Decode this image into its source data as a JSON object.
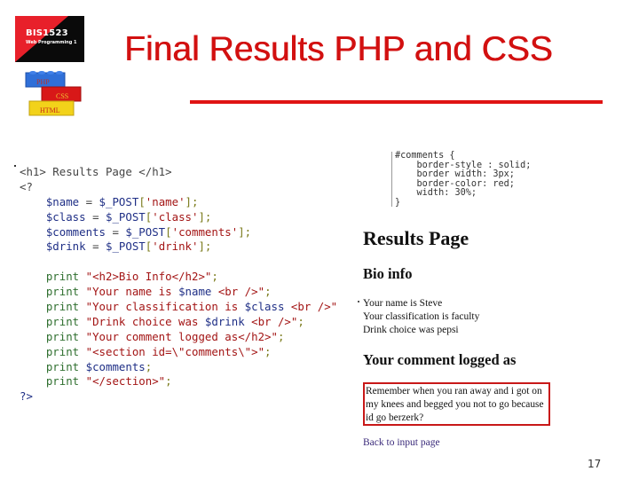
{
  "logo": {
    "course_code": "BIS1523",
    "course_name": "Web Programming 1",
    "bricks": [
      "PHP",
      "CSS",
      "HTML"
    ],
    "colors": {
      "red": "#e8202a",
      "black": "#0a0a0a",
      "blue": "#2f6fd8",
      "brick_red": "#d81818",
      "yellow": "#f2d21a"
    }
  },
  "slide": {
    "title": "Final Results PHP and CSS",
    "title_color": "#d21010",
    "page_number": "17"
  },
  "php_code": {
    "lines": [
      [
        {
          "t": "<h1> Results Page </h1>",
          "c": "tag"
        }
      ],
      [
        {
          "t": "<?",
          "c": "tag"
        }
      ],
      [
        {
          "t": "    "
        },
        {
          "t": "$name",
          "c": "var"
        },
        {
          "t": " = ",
          "c": "tag"
        },
        {
          "t": "$_POST",
          "c": "var"
        },
        {
          "t": "[",
          "c": "punc"
        },
        {
          "t": "'name'",
          "c": "str"
        },
        {
          "t": "];",
          "c": "punc"
        }
      ],
      [
        {
          "t": "    "
        },
        {
          "t": "$class",
          "c": "var"
        },
        {
          "t": " = ",
          "c": "tag"
        },
        {
          "t": "$_POST",
          "c": "var"
        },
        {
          "t": "[",
          "c": "punc"
        },
        {
          "t": "'class'",
          "c": "str"
        },
        {
          "t": "];",
          "c": "punc"
        }
      ],
      [
        {
          "t": "    "
        },
        {
          "t": "$comments",
          "c": "var"
        },
        {
          "t": " = ",
          "c": "tag"
        },
        {
          "t": "$_POST",
          "c": "var"
        },
        {
          "t": "[",
          "c": "punc"
        },
        {
          "t": "'comments'",
          "c": "str"
        },
        {
          "t": "];",
          "c": "punc"
        }
      ],
      [
        {
          "t": "    "
        },
        {
          "t": "$drink",
          "c": "var"
        },
        {
          "t": " = ",
          "c": "tag"
        },
        {
          "t": "$_POST",
          "c": "var"
        },
        {
          "t": "[",
          "c": "punc"
        },
        {
          "t": "'drink'",
          "c": "str"
        },
        {
          "t": "];",
          "c": "punc"
        }
      ],
      [
        {
          "t": ""
        }
      ],
      [
        {
          "t": "    "
        },
        {
          "t": "print",
          "c": "kw"
        },
        {
          "t": " "
        },
        {
          "t": "\"<h2>Bio Info</h2>\"",
          "c": "str"
        },
        {
          "t": ";",
          "c": "punc"
        }
      ],
      [
        {
          "t": "    "
        },
        {
          "t": "print",
          "c": "kw"
        },
        {
          "t": " "
        },
        {
          "t": "\"Your name is ",
          "c": "str"
        },
        {
          "t": "$name",
          "c": "var"
        },
        {
          "t": " <br />\"",
          "c": "str"
        },
        {
          "t": ";",
          "c": "punc"
        }
      ],
      [
        {
          "t": "    "
        },
        {
          "t": "print",
          "c": "kw"
        },
        {
          "t": " "
        },
        {
          "t": "\"Your classification is ",
          "c": "str"
        },
        {
          "t": "$class",
          "c": "var"
        },
        {
          "t": " <br />\"",
          "c": "str"
        }
      ],
      [
        {
          "t": "    "
        },
        {
          "t": "print",
          "c": "kw"
        },
        {
          "t": " "
        },
        {
          "t": "\"Drink choice was ",
          "c": "str"
        },
        {
          "t": "$drink",
          "c": "var"
        },
        {
          "t": " <br />\"",
          "c": "str"
        },
        {
          "t": ";",
          "c": "punc"
        }
      ],
      [
        {
          "t": "    "
        },
        {
          "t": "print",
          "c": "kw"
        },
        {
          "t": " "
        },
        {
          "t": "\"Your comment logged as</h2>\"",
          "c": "str"
        },
        {
          "t": ";",
          "c": "punc"
        }
      ],
      [
        {
          "t": "    "
        },
        {
          "t": "print",
          "c": "kw"
        },
        {
          "t": " "
        },
        {
          "t": "\"<section id=\\\"comments\\\">\"",
          "c": "str"
        },
        {
          "t": ";",
          "c": "punc"
        }
      ],
      [
        {
          "t": "    "
        },
        {
          "t": "print",
          "c": "kw"
        },
        {
          "t": " "
        },
        {
          "t": "$comments",
          "c": "var"
        },
        {
          "t": ";",
          "c": "punc"
        }
      ],
      [
        {
          "t": "    "
        },
        {
          "t": "print",
          "c": "kw"
        },
        {
          "t": " "
        },
        {
          "t": "\"</section>\"",
          "c": "str"
        },
        {
          "t": ";",
          "c": "punc"
        }
      ],
      [
        {
          "t": "?>",
          "c": "var"
        }
      ]
    ]
  },
  "css_code": "#comments {\n    border-style : solid;\n    border width: 3px;\n    border-color: red;\n    width: 30%;\n}",
  "rendered_page": {
    "h1": "Results Page",
    "h2_bio": "Bio info",
    "name_line": "Your name is Steve",
    "class_line": "Your classification is faculty",
    "drink_line": "Drink choice was pepsi",
    "h2_comment": "Your comment logged as",
    "comment_text": "Remember when you ran away and i got on my knees and begged you not to go because id go berzerk?",
    "back_link": "Back to input page",
    "comment_border_color": "#c81818"
  }
}
